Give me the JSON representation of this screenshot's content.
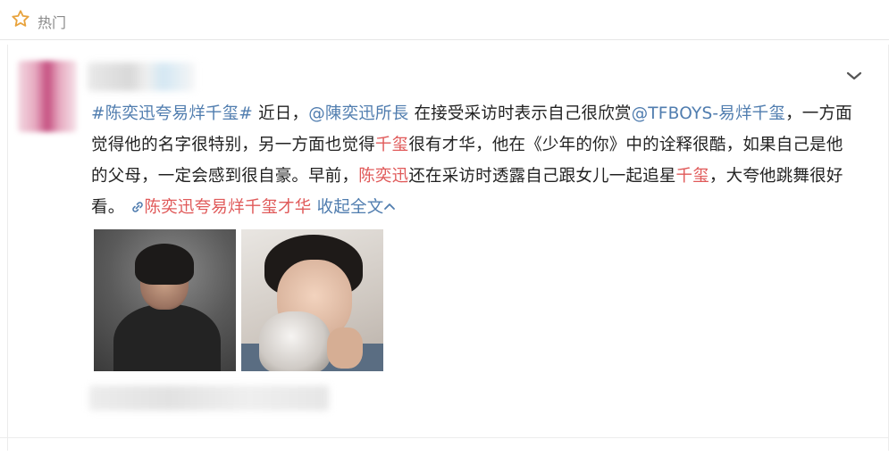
{
  "header": {
    "hot_icon": "star-outline-icon",
    "hot_label": "热门"
  },
  "post": {
    "topic": "#陈奕迅夸易烊千玺#",
    "seg1": " 近日，",
    "mention1": "@陳奕迅所長",
    "seg2": " 在接受采访时表示自己很欣赏",
    "mention2": "@TFBOYS-易烊千玺",
    "seg3": "，一方面觉得他的名字很特别，另一方面也觉得",
    "name1": "千玺",
    "seg4": "很有才华，他在《少年的你》中的诠释很酷，如果自己是他的父母，一定会感到很自豪。早前，",
    "name2": "陈奕迅",
    "seg5": "还在采访时透露自己跟女儿一起追星",
    "name3": "千玺",
    "seg6": "，大夸他跳舞很好看。",
    "link_icon": "link-icon",
    "link_text": "陈奕迅夸易烊千玺才华",
    "collapse_text": "收起全文",
    "collapse_icon": "chevron-up-icon"
  },
  "menu_icon": "chevron-down-icon",
  "colors": {
    "accent": "#eb7350",
    "link_blue": "#507daf",
    "highlight_red": "#e05a5a"
  }
}
